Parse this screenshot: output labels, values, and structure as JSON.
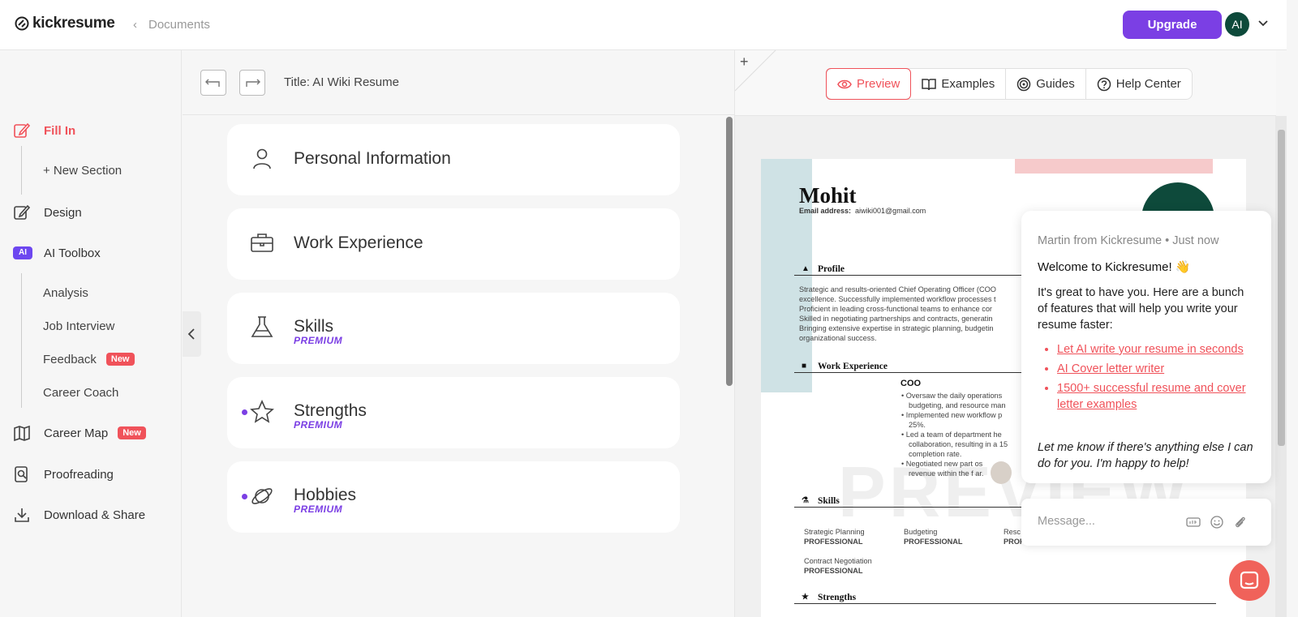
{
  "brand": {
    "name": "kickresume"
  },
  "header": {
    "breadcrumb": "Documents",
    "upgrade_label": "Upgrade",
    "avatar_initials": "AI"
  },
  "sidebar": {
    "fill_in": "Fill In",
    "new_section": "+ New Section",
    "design": "Design",
    "ai_badge": "AI",
    "ai_toolbox": "AI Toolbox",
    "ai_items": [
      "Analysis",
      "Job Interview",
      "Feedback",
      "Career Coach"
    ],
    "new_badge": "New",
    "career_map": "Career Map",
    "proofreading": "Proofreading",
    "download_share": "Download & Share"
  },
  "editor": {
    "title": "Title: AI Wiki Resume",
    "premium_label": "PREMIUM",
    "sections": [
      {
        "title": "Personal Information",
        "icon": "person-icon"
      },
      {
        "title": "Work Experience",
        "icon": "briefcase-icon"
      },
      {
        "title": "Skills",
        "icon": "flask-icon",
        "premium": true
      },
      {
        "title": "Strengths",
        "icon": "star-icon",
        "premium": true
      },
      {
        "title": "Hobbies",
        "icon": "planet-icon",
        "premium": true
      }
    ]
  },
  "preview_tabs": [
    {
      "label": "Preview",
      "icon": "eye-icon",
      "active": true
    },
    {
      "label": "Examples",
      "icon": "book-icon"
    },
    {
      "label": "Guides",
      "icon": "target-icon"
    },
    {
      "label": "Help Center",
      "icon": "question-icon"
    }
  ],
  "resume": {
    "name": "Mohit",
    "email_label": "Email address:",
    "email": "aiwiki001@gmail.com",
    "profile_heading": "Profile",
    "profile_lines": [
      "Strategic and results-oriented Chief Operating Officer (COO",
      "excellence. Successfully implemented workflow processes t",
      "Proficient in leading cross-functional teams to enhance cor",
      "Skilled in negotiating partnerships and contracts, generatin",
      "Bringing extensive expertise in strategic planning, budgetin",
      "organizational success."
    ],
    "work_heading": "Work Experience",
    "job_title": "COO",
    "job_bullets": [
      "Oversaw the daily operations",
      "budgeting, and resource man",
      "Implemented new workflow p",
      "25%.",
      "Led a team of department he",
      "collaboration, resulting in a 15",
      "completion rate.",
      "Negotiated new part   os",
      "revenue within the f   ar."
    ],
    "skills_heading": "Skills",
    "skills": [
      {
        "name": "Strategic Planning",
        "level": "PROFESSIONAL"
      },
      {
        "name": "Budgeting",
        "level": "PROFESSIONAL"
      },
      {
        "name": "Resc",
        "level": "PROF"
      },
      {
        "name": "Contract Negotiation",
        "level": "PROFESSIONAL"
      }
    ],
    "strengths_heading": "Strengths",
    "watermark": "PREVIEW"
  },
  "chat": {
    "from": "Martin from Kickresume • Just now",
    "welcome": "Welcome to Kickresume! 👋",
    "intro": "It's great to have you. Here are a bunch of features that will help you write your resume faster:",
    "links": [
      "Let AI write your resume in seconds",
      "AI Cover letter writer",
      "1500+ successful resume and cover letter examples"
    ],
    "outro": "Let me know if there's anything else I can do for you. I'm happy to help!",
    "message_placeholder": "Message..."
  },
  "colors": {
    "accent": "#f0525a",
    "brand": "#7b3fe4",
    "avatar": "#0e4a3b"
  }
}
